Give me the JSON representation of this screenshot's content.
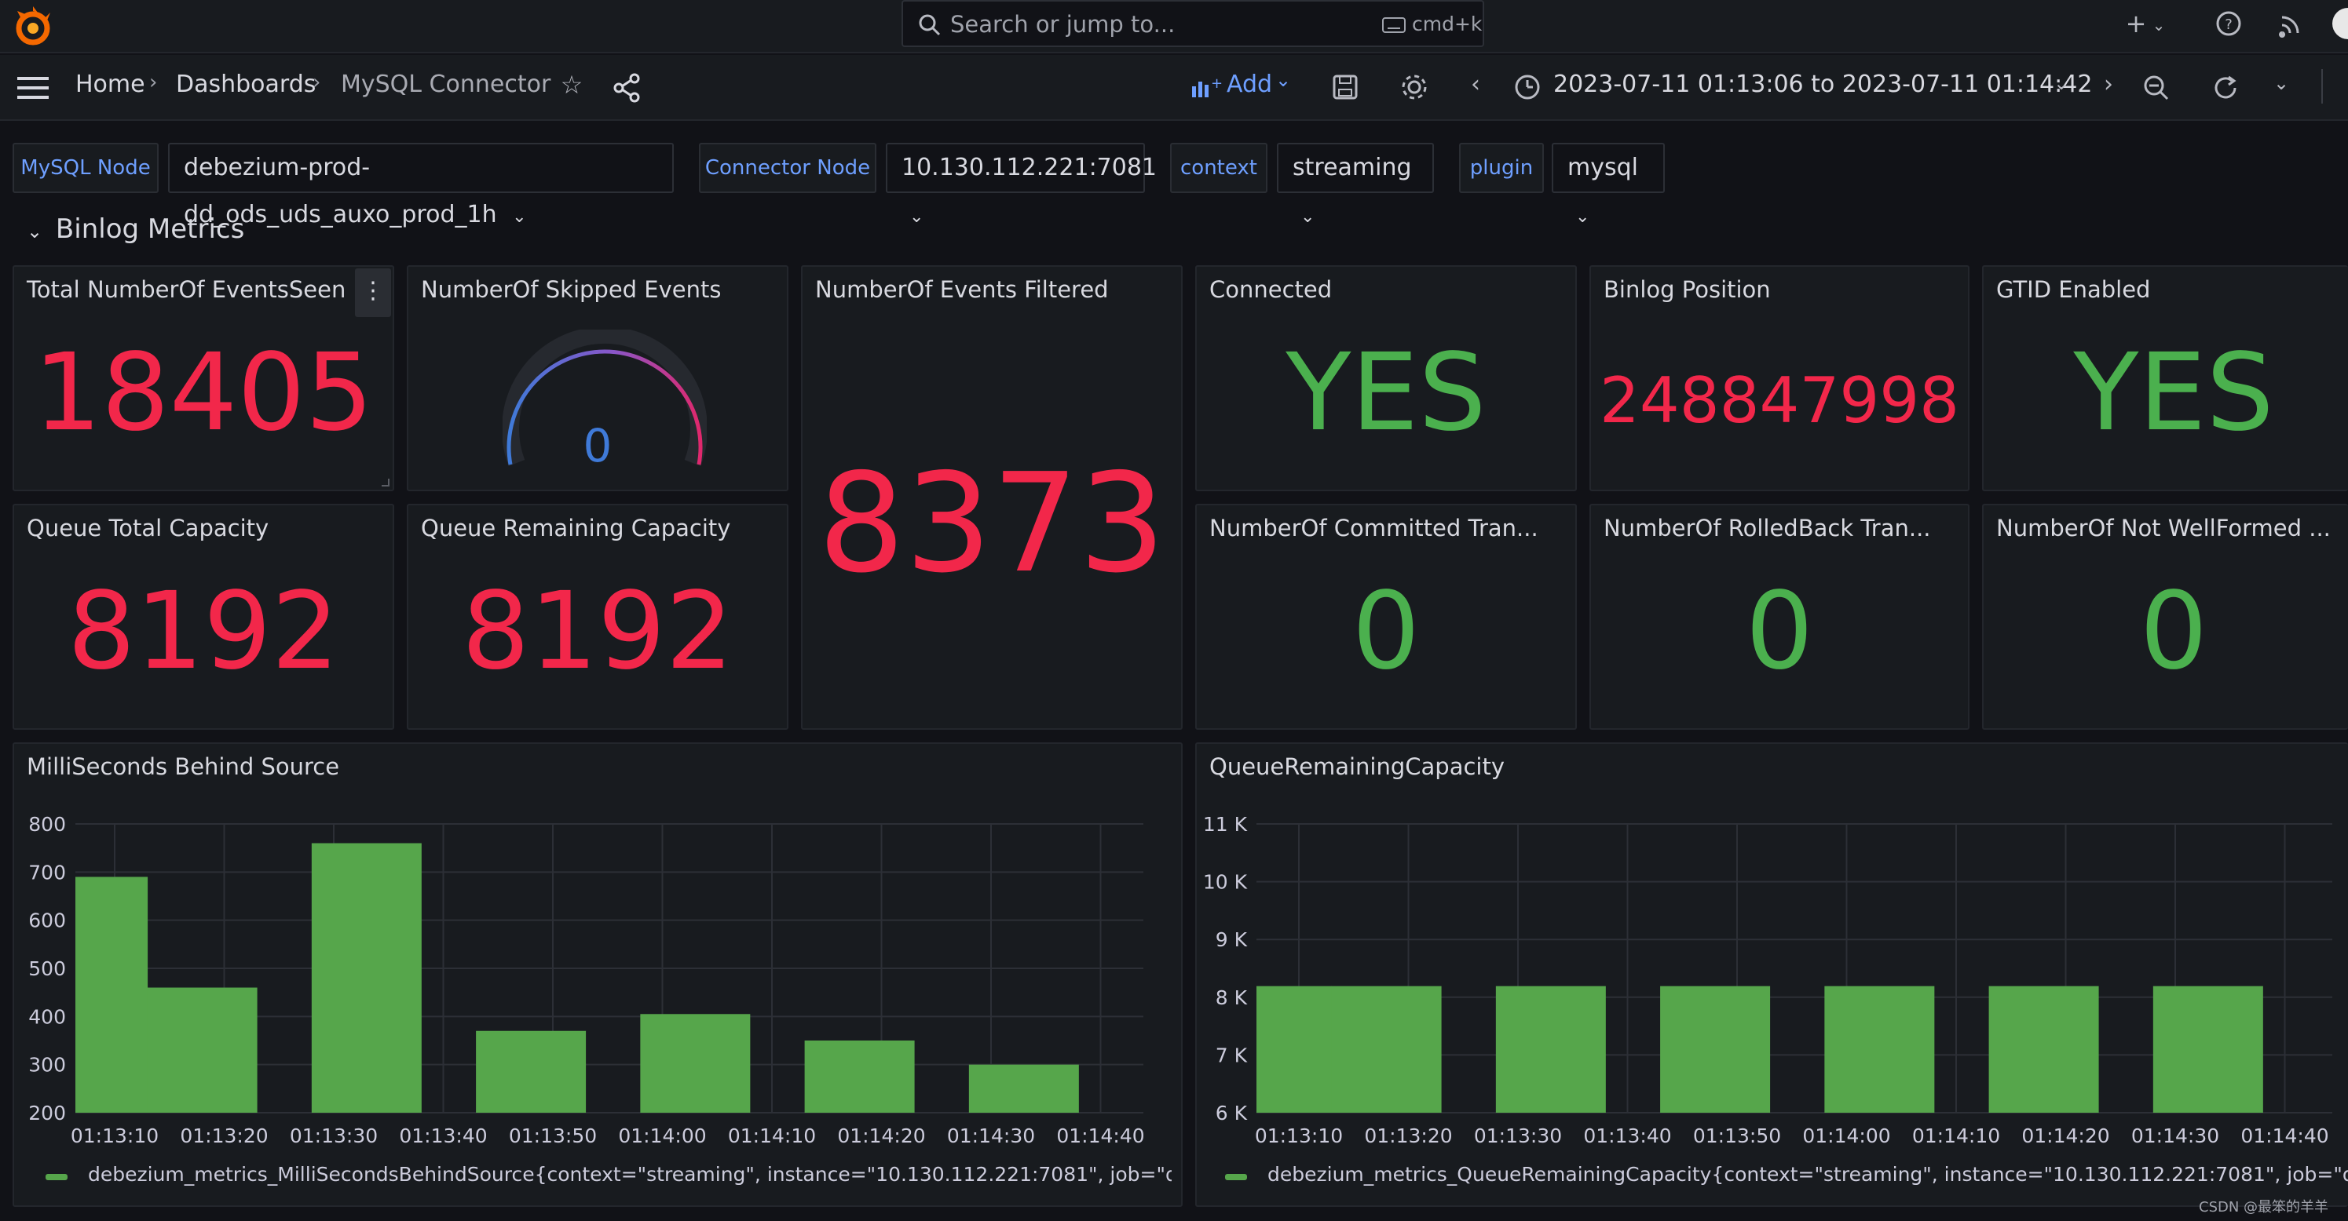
{
  "topbar": {
    "search_placeholder": "Search or jump to...",
    "shortcut": "cmd+k",
    "icons": [
      "grafana-logo-icon",
      "plus-icon",
      "help-icon",
      "news-icon",
      "user-avatar"
    ]
  },
  "navbar": {
    "breadcrumb": [
      "Home",
      "Dashboards",
      "MySQL Connector"
    ],
    "add_label": "Add",
    "time_range": "2023-07-11 01:13:06 to 2023-07-11 01:14:42"
  },
  "variables": [
    {
      "label": "MySQL Node",
      "value": "debezium-prod-dd_ods_uds_auxo_prod_1h"
    },
    {
      "label": "Connector Node",
      "value": "10.130.112.221:7081"
    },
    {
      "label": "context",
      "value": "streaming"
    },
    {
      "label": "plugin",
      "value": "mysql"
    }
  ],
  "row_title": "Binlog Metrics",
  "colors": {
    "red": "#f2274a",
    "green": "#4bb04e",
    "blue": "#3f7ad8",
    "bar": "#56a64b"
  },
  "panels": {
    "events_seen": {
      "title": "Total NumberOf EventsSeen",
      "value": "18405"
    },
    "skipped": {
      "title": "NumberOf Skipped Events",
      "value": "0"
    },
    "filtered": {
      "title": "NumberOf Events Filtered",
      "value": "8373"
    },
    "connected": {
      "title": "Connected",
      "value": "YES"
    },
    "binlog_pos": {
      "title": "Binlog Position",
      "value": "248847998"
    },
    "gtid": {
      "title": "GTID Enabled",
      "value": "YES"
    },
    "queue_total": {
      "title": "Queue Total Capacity",
      "value": "8192"
    },
    "queue_remaining": {
      "title": "Queue Remaining Capacity",
      "value": "8192"
    },
    "committed": {
      "title": "NumberOf Committed Tran...",
      "value": "0"
    },
    "rolledback": {
      "title": "NumberOf RolledBack Tran...",
      "value": "0"
    },
    "not_wellformed": {
      "title": "NumberOf Not WellFormed ...",
      "value": "0"
    }
  },
  "chart_data": [
    {
      "type": "bar",
      "title": "MilliSeconds Behind Source",
      "categories": [
        "01:13:10",
        "01:13:20",
        "01:13:30",
        "01:13:40",
        "01:13:50",
        "01:14:00",
        "01:14:10",
        "01:14:20",
        "01:14:30",
        "01:14:40"
      ],
      "y_ticks": [
        "800",
        "700",
        "600",
        "500",
        "400",
        "300",
        "200"
      ],
      "ylim": [
        200,
        800
      ],
      "bars": [
        {
          "x": "01:13:08",
          "value": 690
        },
        {
          "x": "01:13:18",
          "value": 460
        },
        {
          "x": "01:13:33",
          "value": 760
        },
        {
          "x": "01:13:48",
          "value": 370
        },
        {
          "x": "01:14:03",
          "value": 405
        },
        {
          "x": "01:14:18",
          "value": 350
        },
        {
          "x": "01:14:33",
          "value": 300
        }
      ],
      "legend": "debezium_metrics_MilliSecondsBehindSource{context=\"streaming\", instance=\"10.130.112.221:7081\", job=\"debezium-prc"
    },
    {
      "type": "bar",
      "title": "QueueRemainingCapacity",
      "categories": [
        "01:13:10",
        "01:13:20",
        "01:13:30",
        "01:13:40",
        "01:13:50",
        "01:14:00",
        "01:14:10",
        "01:14:20",
        "01:14:30",
        "01:14:40"
      ],
      "y_ticks": [
        "11 K",
        "10 K",
        "9 K",
        "8 K",
        "7 K",
        "6 K"
      ],
      "ylim": [
        6000,
        11000
      ],
      "bars": [
        {
          "x": "01:13:08",
          "value": 8192
        },
        {
          "x": "01:13:18",
          "value": 8192
        },
        {
          "x": "01:13:33",
          "value": 8192
        },
        {
          "x": "01:13:48",
          "value": 8192
        },
        {
          "x": "01:14:03",
          "value": 8192
        },
        {
          "x": "01:14:18",
          "value": 8192
        },
        {
          "x": "01:14:33",
          "value": 8192
        }
      ],
      "legend": "debezium_metrics_QueueRemainingCapacity{context=\"streaming\", instance=\"10.130.112.221:7081\", job=\"debezium-pro"
    }
  ],
  "watermark": "CSDN @最笨的羊羊"
}
